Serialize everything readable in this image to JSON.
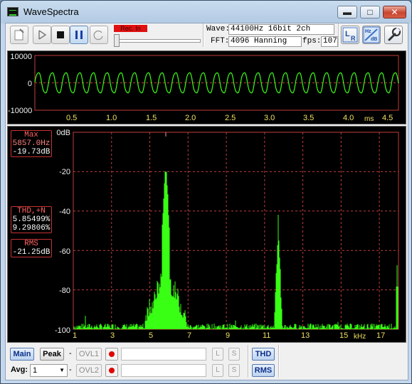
{
  "window": {
    "title": "WaveSpectra"
  },
  "toolbar": {
    "rec_label": "Rec. In",
    "wave_label": "Wave:",
    "wave_value": "44100Hz 16bit 2ch",
    "fft_label": "FFT:",
    "fft_value": "4096 Hanning",
    "fps_label": "fps:",
    "fps_value": "107",
    "lr_icon_text": "LR",
    "hz_icon_text": "Hz dB"
  },
  "wave_panel": {
    "y_labels": [
      "10000",
      "0",
      "-10000"
    ],
    "x_labels": [
      "0.5",
      "1.0",
      "1.5",
      "2.0",
      "2.5",
      "3.0",
      "3.5",
      "4.0",
      "4.5"
    ],
    "x_unit": "ms"
  },
  "spectrum_panel": {
    "y_labels": [
      "0dB",
      "-20",
      "-40",
      "-60",
      "-80",
      "-100"
    ],
    "x_labels": [
      "1",
      "3",
      "5",
      "7",
      "9",
      "11",
      "13",
      "15",
      "17"
    ],
    "x_unit": "kHz",
    "max_box": {
      "title": "Max",
      "freq": "5857.0Hz",
      "level": "-19.73dB"
    },
    "thd_box": {
      "title": "THD,+N",
      "v1": "5.85499%",
      "v2": "9.29806%"
    },
    "rms_box": {
      "title": "RMS",
      "value": "-21.25dB"
    }
  },
  "bottom": {
    "main_label": "Main",
    "peak_label": "Peak",
    "dash1": "-",
    "dash2": "-",
    "ovl1_label": "OVL1",
    "ovl2_label": "OVL2",
    "l_label": "L",
    "s_label": "S",
    "thd_label": "THD",
    "rms_label": "RMS",
    "avg_label": "Avg:",
    "avg_value": "1"
  },
  "colors": {
    "trace": "#39ff14",
    "grid": "#c03c3c",
    "axis_text": "#f0e060"
  }
}
